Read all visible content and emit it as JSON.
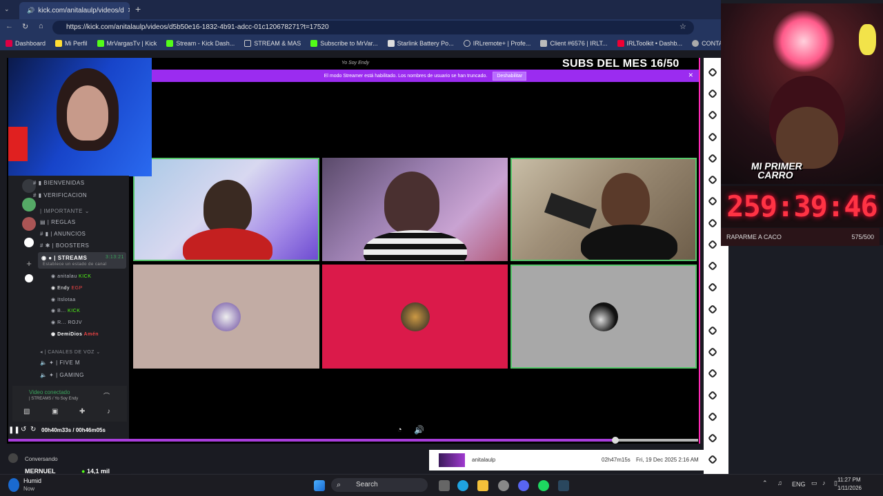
{
  "browser": {
    "tab_title": "kick.com/anitalaulp/videos/d",
    "url": "https://kick.com/anitalaulp/videos/d5b50e16-1832-4b91-adcc-01c120678271?t=17520",
    "bookmarks": [
      "Dashboard",
      "Mi Perfil",
      "MrVargasTv | Kick",
      "Stream - Kick Dash...",
      "STREAM & MAS",
      "Subscribe to MrVar...",
      "Starlink Battery Po...",
      "IRLremote+ | Profe...",
      "Client #6576 | IRLT...",
      "IRLToolkit • Dashb...",
      "CONTADOR"
    ]
  },
  "stream": {
    "subs_label": "SUBS DEL MES 16/50",
    "watermark": "Yo Soy Endy",
    "banner_text": "El modo Streamer está habilitado. Los nombres de usuario se han truncado.",
    "banner_button": "Deshabilitar",
    "time_display": "00h40m33s / 00h46m05s",
    "progress": 0.88
  },
  "discord": {
    "channels": [
      "BIENVENIDAS",
      "VERIFICACION"
    ],
    "category_important": "IMPORTANTE",
    "important_channels": [
      "REGLAS",
      "ANUNCIOS",
      "BOOSTERS"
    ],
    "streams_channel": "STREAMS",
    "streams_time": "3:13:21",
    "streams_status": "Establece un estado de canal",
    "members": [
      {
        "name": "anitalau",
        "tag": "KICK"
      },
      {
        "name": "Endy",
        "tag": "EGP"
      },
      {
        "name": "Itslotaa",
        "tag": ""
      },
      {
        "name": "B...",
        "tag": "KICK"
      },
      {
        "name": "R...",
        "tag": "ROJV"
      },
      {
        "name": "DemiDios",
        "tag": "Amén"
      }
    ],
    "voice_category": "CANALES DE VOZ",
    "voice_channels": [
      "FIVE M",
      "GAMING"
    ],
    "video_status": "Video conectado",
    "video_sub": "| STREAMS / Yo Soy Endy"
  },
  "vod": {
    "channel": "anitalaulp",
    "duration": "02h47m15s",
    "date": "Fri, 19 Dec 2025 2:16 AM"
  },
  "left_bottom": {
    "conversando": "Conversando",
    "user": "MERNUEL",
    "viewers": "14,1 mil"
  },
  "overlay": {
    "banner": "MI PRIMER CARRO",
    "timer": "259:39:46",
    "goal_label": "RAPARME A CACO",
    "goal_value": "575/500"
  },
  "taskbar": {
    "weather": "Humid",
    "weather_sub": "Now",
    "search": "Search",
    "lang": "ENG",
    "time": "11:27 PM",
    "date": "1/11/2026"
  }
}
